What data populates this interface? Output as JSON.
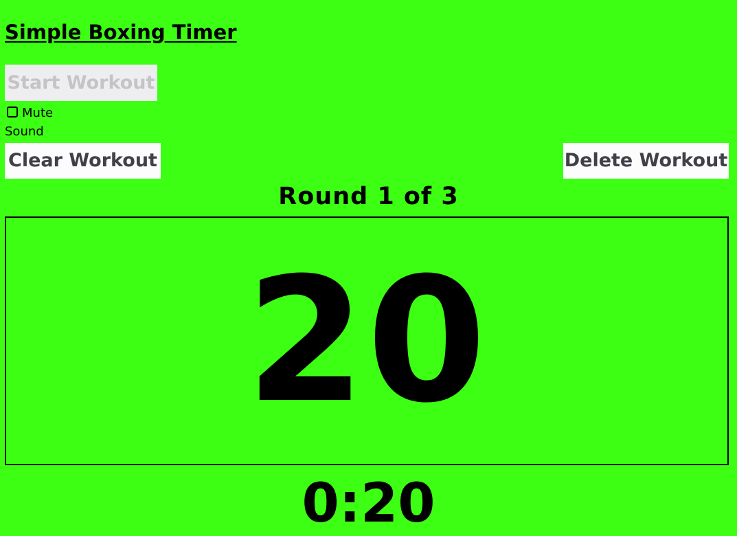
{
  "app": {
    "title": "Simple Boxing Timer",
    "background_color": "#3cff14"
  },
  "controls": {
    "start_label": "Start Workout",
    "start_disabled": true,
    "mute_label": "Mute",
    "mute_checked": false,
    "sound_label": "Sound",
    "clear_label": "Clear Workout",
    "delete_label": "Delete Workout"
  },
  "timer": {
    "round_text": "Round 1 of 3",
    "countdown": "20",
    "clock": "0:20"
  }
}
